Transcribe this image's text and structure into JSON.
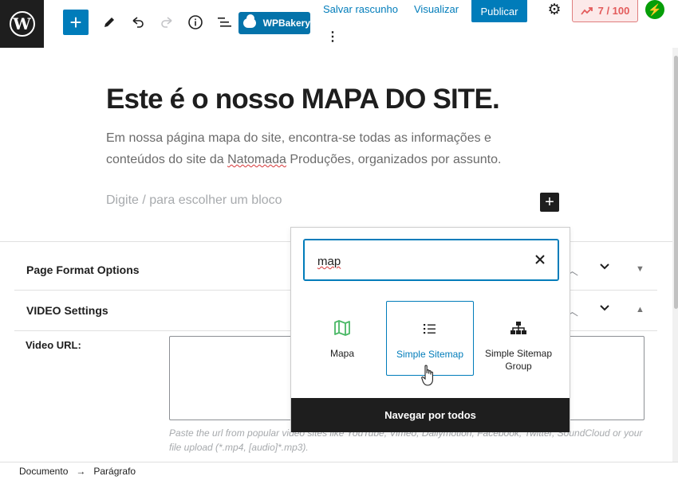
{
  "toolbar": {
    "save_draft": "Salvar rascunho",
    "preview": "Visualizar",
    "publish": "Publicar",
    "wpbakery": "WPBakery",
    "score": "7 / 100",
    "icons": [
      "wordpress-icon",
      "plus-icon",
      "pencil-icon",
      "undo-icon",
      "redo-icon",
      "info-icon",
      "list-view-icon",
      "cloud-icon",
      "kebab-icon",
      "gear-icon",
      "score-icon",
      "jetpack-icon"
    ]
  },
  "content": {
    "title": "Este é o nosso MAPA DO SITE.",
    "paragraph_before": "Em nossa página mapa do site, encontra-se todas as informações e conteúdos do site da ",
    "paragraph_misspelled": "Natomada",
    "paragraph_after": " Produções, organizados por assunto.",
    "placeholder": "Digite / para escolher um bloco"
  },
  "meta": {
    "page_format": "Page Format Options",
    "video_settings": "VIDEO Settings",
    "video_url_label": "Video URL:",
    "video_help": "Paste the url from popular video sites like YouTube, Vimeo, Dailymotion, Facebook, Twitter, SoundCloud or your file upload (*.mp4, [audio]*.mp3)."
  },
  "inserter": {
    "search_value": "map",
    "blocks": [
      {
        "label": "Mapa",
        "icon": "map-icon"
      },
      {
        "label": "Simple Sitemap",
        "icon": "list-icon"
      },
      {
        "label": "Simple Sitemap Group",
        "icon": "sitemap-icon"
      }
    ],
    "browse_all": "Navegar por todos"
  },
  "statusbar": {
    "document": "Documento",
    "arrow": "→",
    "paragraph": "Parágrafo"
  },
  "colors": {
    "accent": "#007cba",
    "dark": "#1e1e1e",
    "map_icon": "#4ab866",
    "score_red": "#e35b5b",
    "jetpack_green": "#069e08"
  }
}
